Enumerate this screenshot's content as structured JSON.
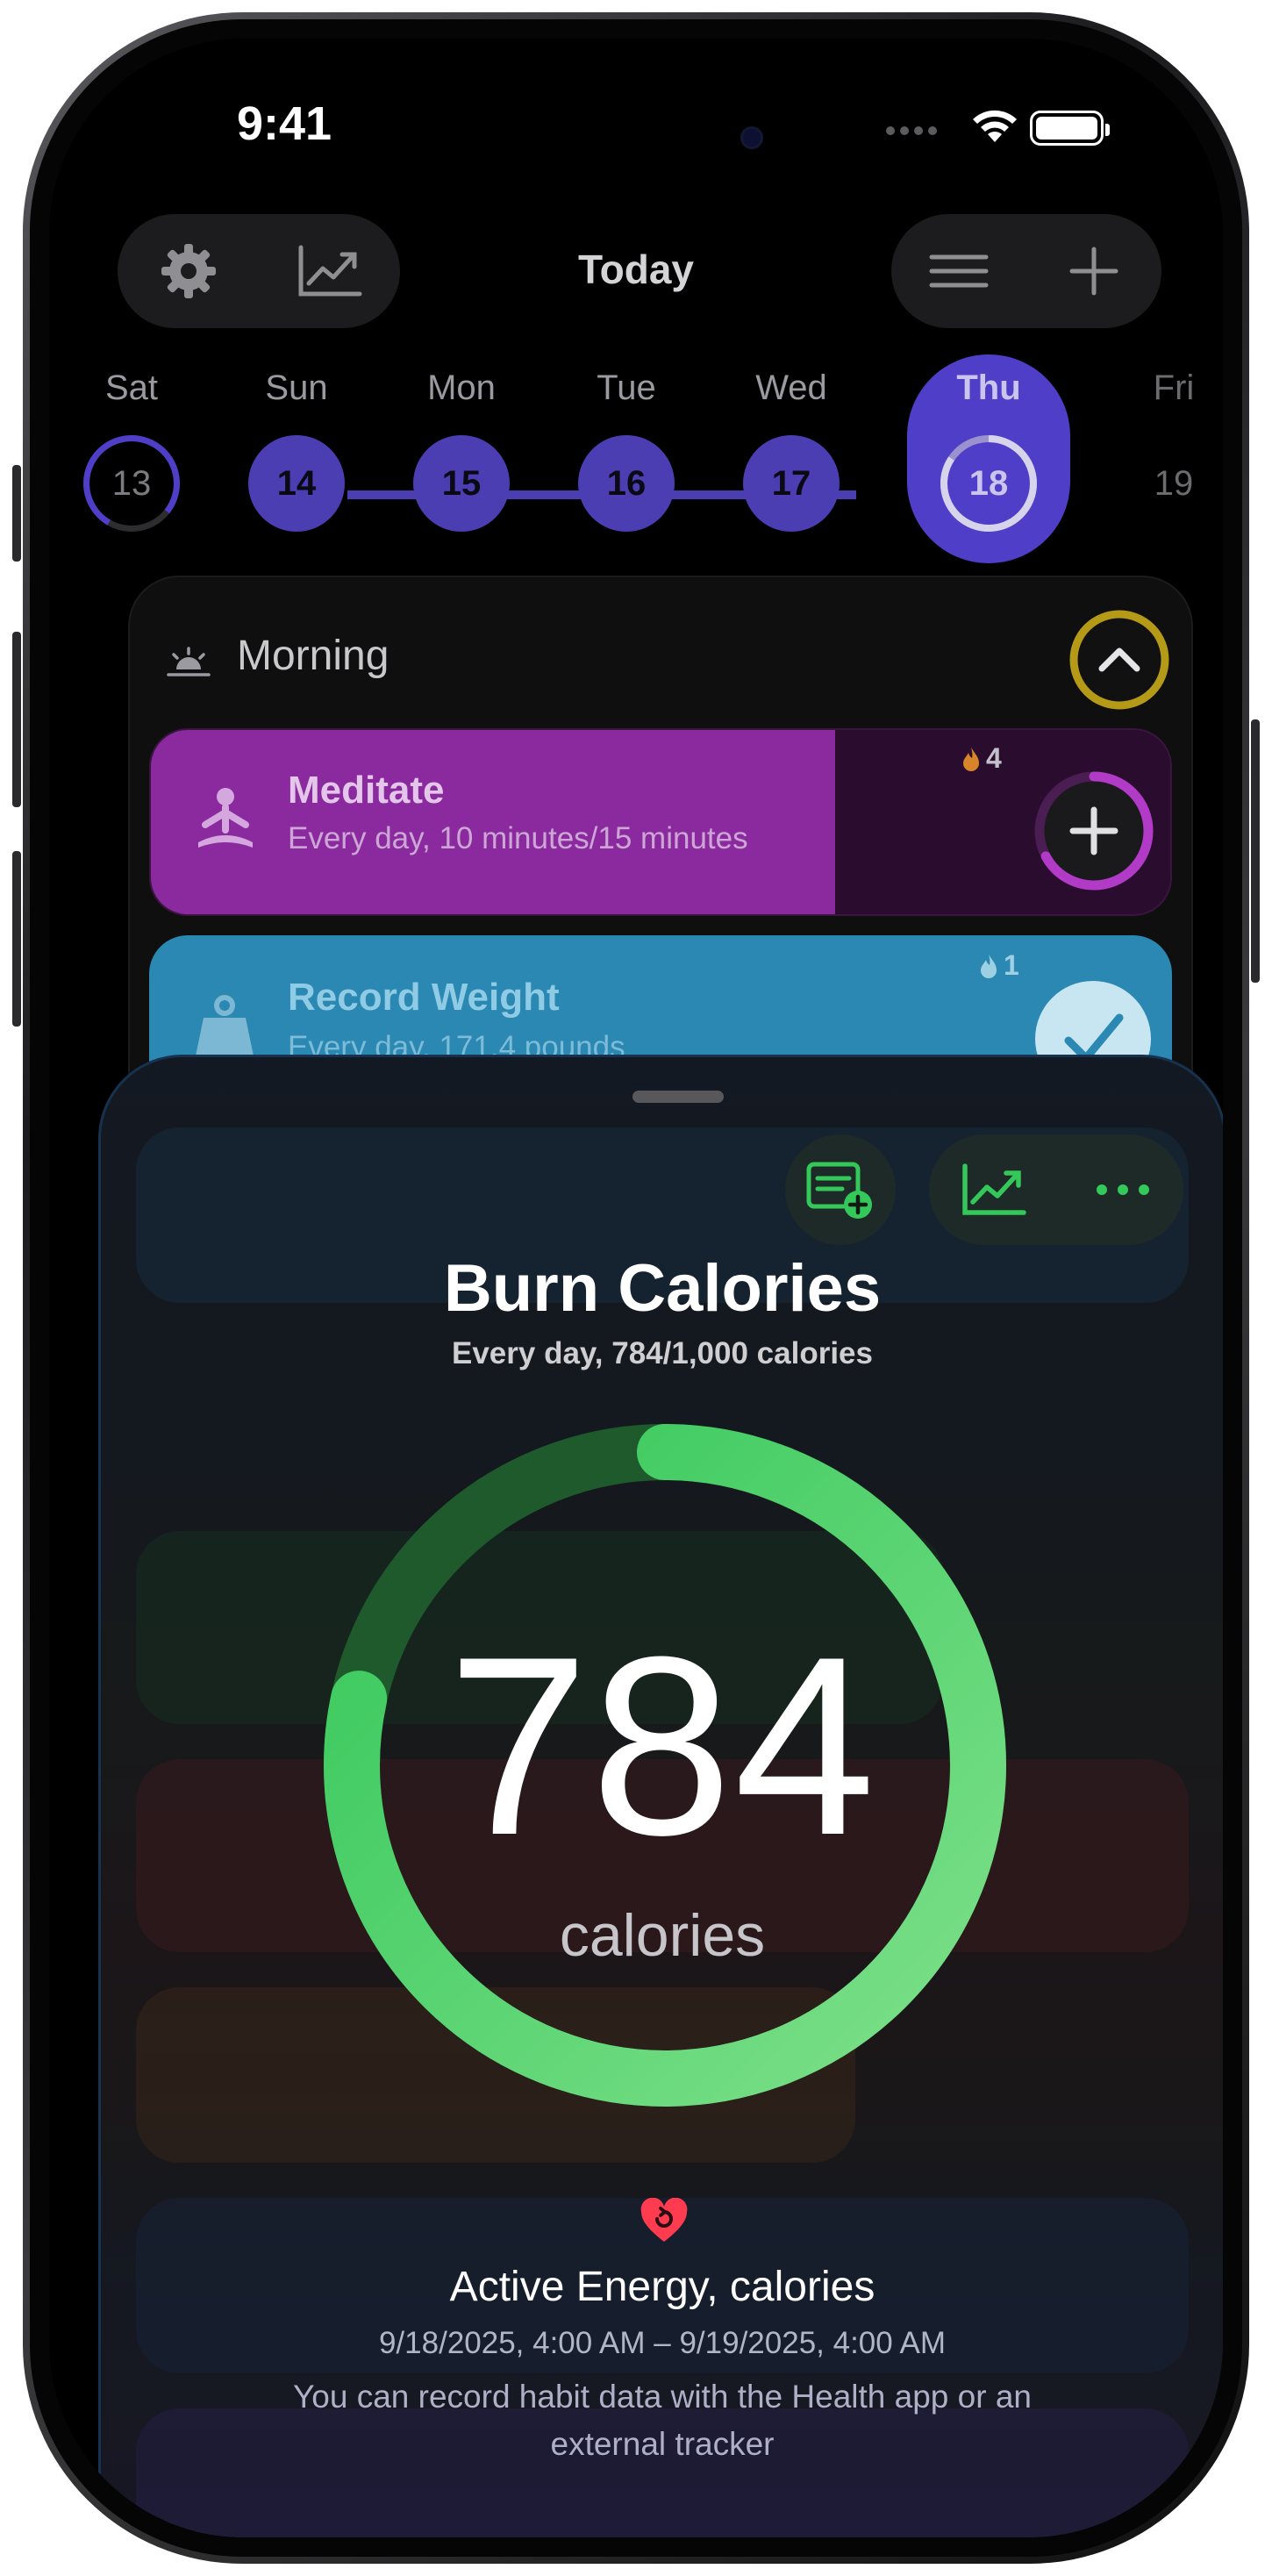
{
  "status_bar": {
    "time": "9:41"
  },
  "toolbar": {
    "title": "Today",
    "settings_icon": "gear-icon",
    "stats_icon": "chart-line-icon",
    "menu_icon": "list-icon",
    "add_icon": "plus-icon"
  },
  "week": {
    "days": [
      {
        "label": "Sat",
        "date": "13",
        "state": "partial"
      },
      {
        "label": "Sun",
        "date": "14",
        "state": "complete"
      },
      {
        "label": "Mon",
        "date": "15",
        "state": "complete"
      },
      {
        "label": "Tue",
        "date": "16",
        "state": "complete"
      },
      {
        "label": "Wed",
        "date": "17",
        "state": "complete"
      },
      {
        "label": "Thu",
        "date": "18",
        "state": "selected"
      },
      {
        "label": "Fri",
        "date": "19",
        "state": "future"
      }
    ]
  },
  "section": {
    "title": "Morning",
    "progress": 1.0
  },
  "habits": [
    {
      "title": "Meditate",
      "subtitle": "Every day, 10 minutes/15 minutes",
      "streak": "4",
      "progress": 0.67,
      "color": "#8a2a9e"
    },
    {
      "title": "Record Weight",
      "subtitle": "Every day, 171.4 pounds",
      "streak": "1",
      "progress": 1.0,
      "color": "#2a8ab8"
    }
  ],
  "sheet": {
    "title": "Burn Calories",
    "subtitle": "Every day, 784/1,000 calories",
    "value": "784",
    "unit": "calories",
    "progress": 0.784,
    "source_title": "Active Energy, calories",
    "source_range": "9/18/2025, 4:00 AM – 9/19/2025, 4:00 AM",
    "source_note": "You can record habit data with the Health app or an external tracker",
    "accent": "#34c759"
  }
}
